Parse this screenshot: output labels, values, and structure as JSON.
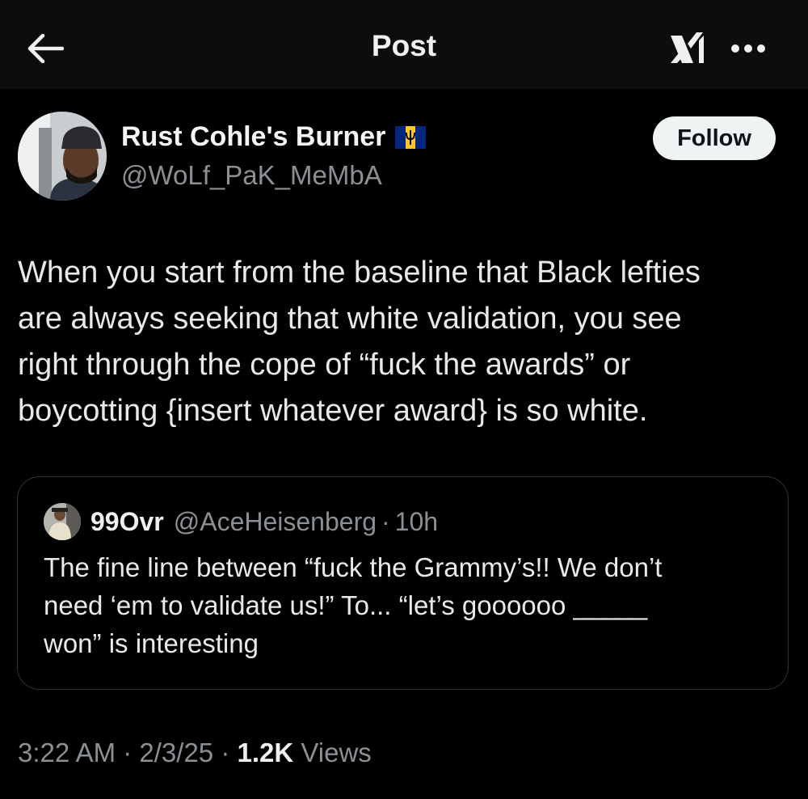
{
  "topbar": {
    "title": "Post",
    "back_icon": "arrow-left-icon",
    "grok_icon": "grok-logo-icon",
    "more_icon": "more-horizontal-icon"
  },
  "author": {
    "display_name": "Rust Cohle's Burner",
    "flag_icon": "barbados-flag-icon",
    "handle": "@WoLf_PaK_MeMbA",
    "follow_label": "Follow"
  },
  "post": {
    "lines": [
      "When you start from the baseline that Black lefties",
      "are always seeking that white validation, you see",
      "right through the cope of “fuck the awards” or",
      "boycotting {insert whatever award} is so white."
    ]
  },
  "quote": {
    "name": "99Ovr",
    "handle": "@AceHeisenberg",
    "separator": "·",
    "time": "10h",
    "lines": [
      "The fine line between “fuck the Grammy’s!! We don’t",
      "need ‘em to validate us!” To... “let’s goooooo _____",
      "won” is interesting"
    ]
  },
  "meta": {
    "time": "3:22 AM",
    "sep1": " · ",
    "date": "2/3/25",
    "sep2": " · ",
    "views_count": "1.2K",
    "views_label": " Views"
  },
  "colors": {
    "background": "#000000",
    "text": "#e7e9ea",
    "muted": "#8b9095",
    "border": "#2f3336",
    "follow_bg": "#eff3f4"
  }
}
